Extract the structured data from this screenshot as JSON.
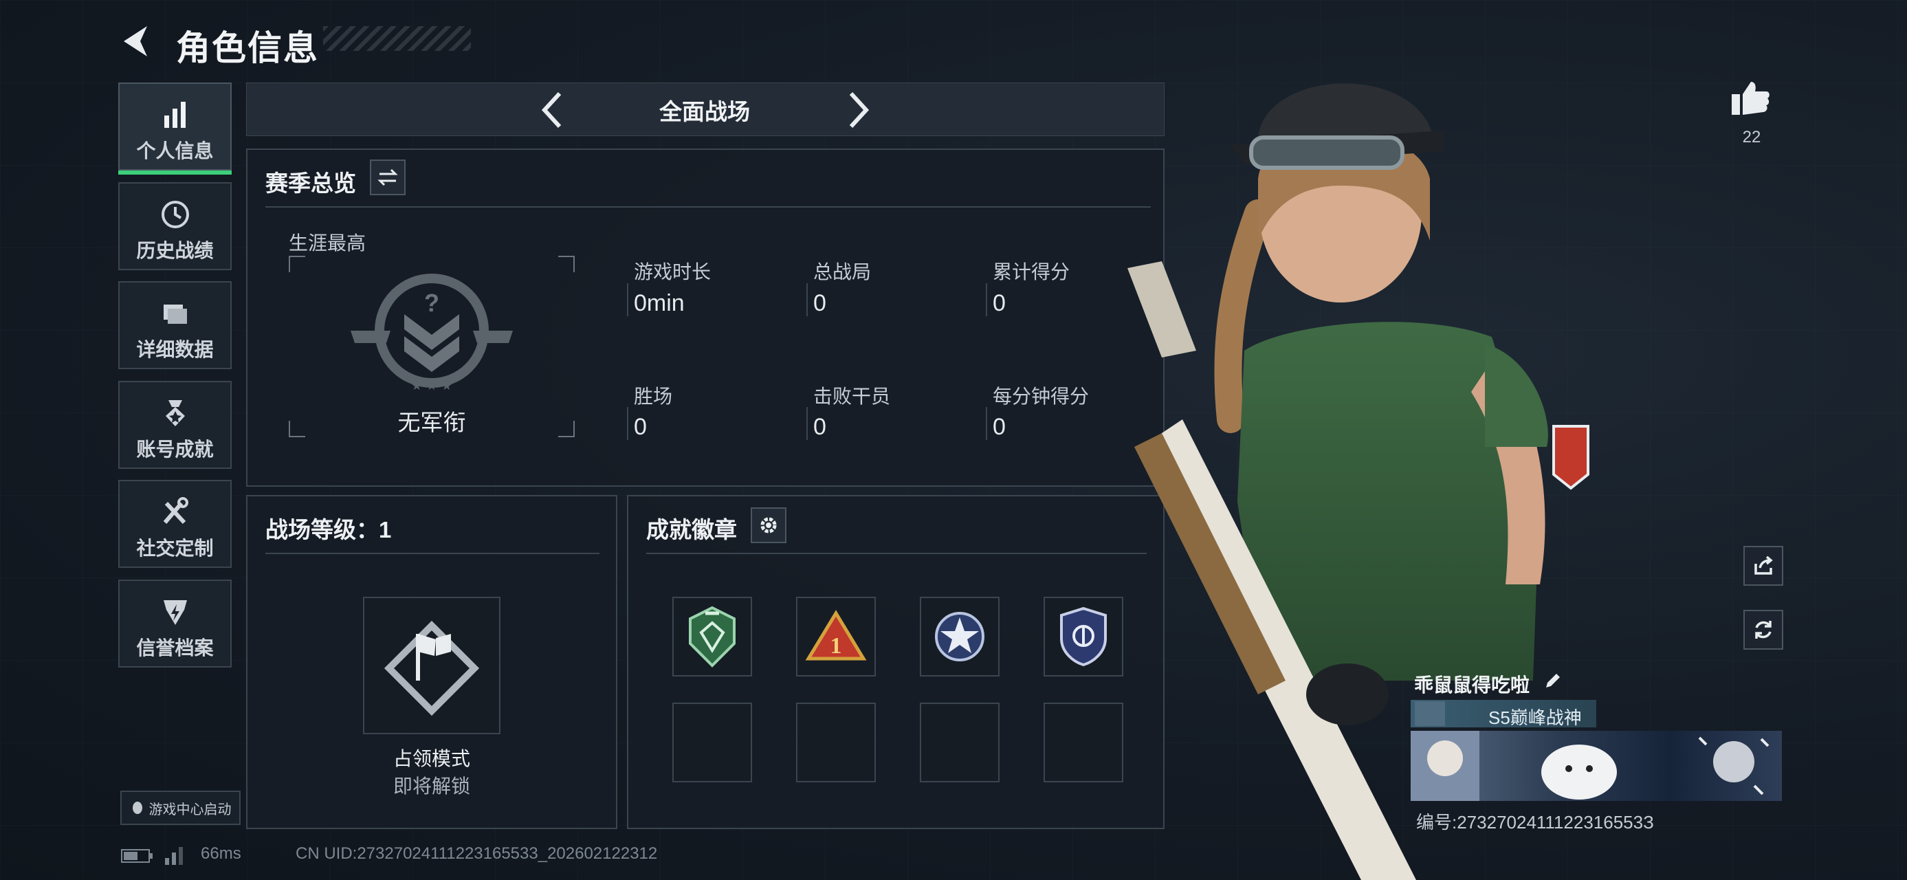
{
  "header": {
    "title": "角色信息"
  },
  "nav": [
    {
      "label": "个人信息",
      "icon": "bar-chart-icon",
      "active": true
    },
    {
      "label": "历史战绩",
      "icon": "history-clock-icon"
    },
    {
      "label": "详细数据",
      "icon": "folder-icon"
    },
    {
      "label": "账号成就",
      "icon": "achievement-medal-icon"
    },
    {
      "label": "社交定制",
      "icon": "tools-icon"
    },
    {
      "label": "信誉档案",
      "icon": "credit-shield-icon"
    }
  ],
  "game_center_label": "游戏中心启动",
  "mode": {
    "title": "全面战场"
  },
  "season": {
    "title": "赛季总览",
    "career_label": "生涯最高",
    "rank_label": "无军衔",
    "stats": [
      {
        "label": "游戏时长",
        "value": "0min"
      },
      {
        "label": "总战局",
        "value": "0"
      },
      {
        "label": "累计得分",
        "value": "0"
      },
      {
        "label": "胜场",
        "value": "0"
      },
      {
        "label": "击败干员",
        "value": "0"
      },
      {
        "label": "每分钟得分",
        "value": "0"
      }
    ]
  },
  "battlefield": {
    "title": "战场等级：1",
    "mode_name": "占领模式",
    "mode_status": "即将解锁"
  },
  "badges": {
    "title": "成就徽章"
  },
  "likes": {
    "count": "22"
  },
  "player": {
    "name": "乖鼠鼠得吃啦",
    "rank": "S5巅峰战神",
    "id": "编号:2732702411122316553З"
  },
  "status_bar": {
    "ping": "66ms",
    "uid": "CN UID:27327024111223165533_202602122312"
  },
  "colors": {
    "accent": "#3ccf7a",
    "panel_border": "#3a4550",
    "background": "#141b24"
  }
}
